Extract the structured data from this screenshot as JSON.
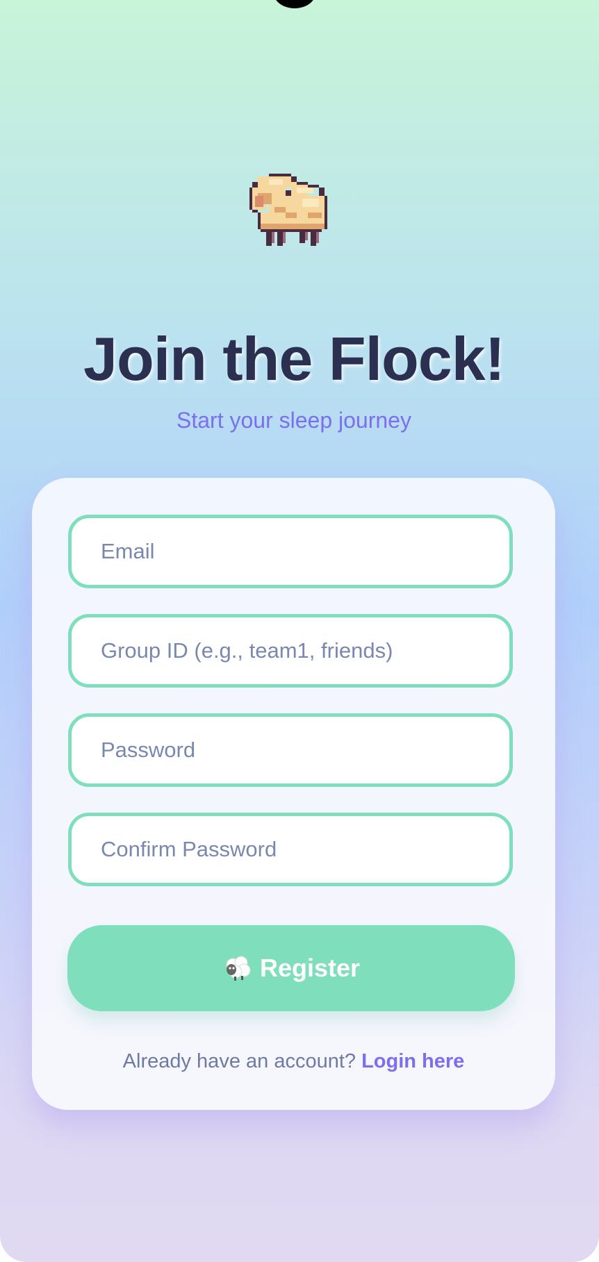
{
  "app": {
    "title": "Join the Flock!",
    "subtitle": "Start your sleep journey"
  },
  "form": {
    "email_placeholder": "Email",
    "group_placeholder": "Group ID (e.g., team1, friends)",
    "password_placeholder": "Password",
    "confirm_placeholder": "Confirm Password",
    "register_label": "Register"
  },
  "footer": {
    "prompt": "Already have an account? ",
    "login_label": "Login here"
  },
  "icons": {
    "logo": "sheep-icon",
    "register_icon": "sheep-icon"
  },
  "colors": {
    "accent": "#7fdfbd",
    "title": "#2b3050",
    "link": "#7b6ff0",
    "background_top": "#c8f4d9",
    "background_bottom": "#e1d9f2"
  }
}
